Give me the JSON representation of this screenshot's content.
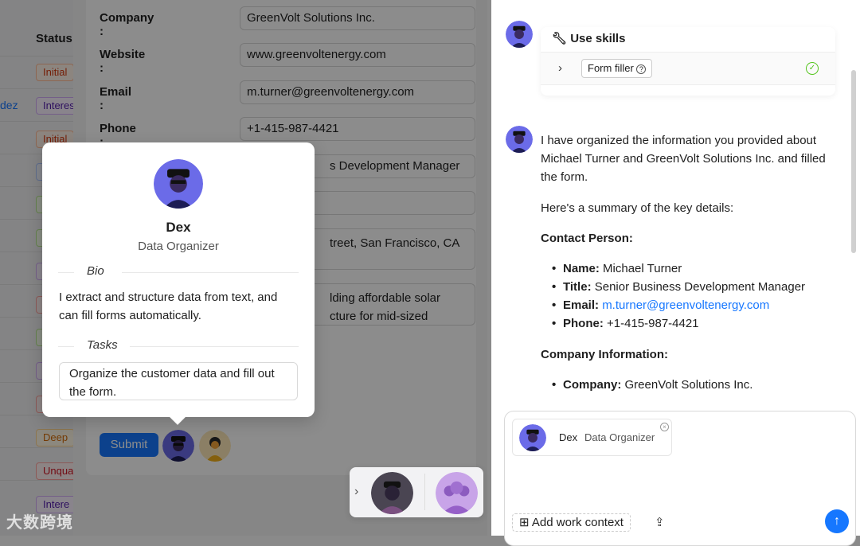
{
  "background_table": {
    "status_header": "Status",
    "name_fragment": "dez",
    "tags": [
      "Initial",
      "Interes",
      "Initial",
      "Deep",
      "Unqua",
      "Intere"
    ]
  },
  "form": {
    "fields": [
      {
        "label": "Company :",
        "value": "GreenVolt Solutions Inc."
      },
      {
        "label": "Website :",
        "value": "www.greenvoltenergy.com"
      },
      {
        "label": "Email :",
        "value": "m.turner@greenvoltenergy.com"
      },
      {
        "label": "Phone :",
        "value": "+1-415-987-4421"
      }
    ],
    "title_fragment": "s Development Manager",
    "address_fragment": "treet, San Francisco, CA",
    "desc_line1": "lding affordable solar",
    "desc_line2": "cture for mid-sized",
    "submit_label": "Submit"
  },
  "popover": {
    "name": "Dex",
    "role": "Data Organizer",
    "bio_label": "Bio",
    "bio": "I extract and structure data from text, and can fill forms automatically.",
    "tasks_label": "Tasks",
    "task": "Organize the customer data and fill out the form."
  },
  "chat": {
    "skills_title": "Use skills",
    "skill_name": "Form filler",
    "intro": "I have organized the information you provided about Michael Turner and GreenVolt Solutions Inc. and filled the form.",
    "summary_intro": "Here's a summary of the key details:",
    "contact_heading": "Contact Person:",
    "contact": {
      "name_label": "Name:",
      "name": "Michael Turner",
      "title_label": "Title:",
      "title": "Senior Business Development Manager",
      "email_label": "Email:",
      "email": "m.turner@greenvoltenergy.com",
      "phone_label": "Phone:",
      "phone": "+1-415-987-4421"
    },
    "company_heading": "Company Information:",
    "company_label": "Company:",
    "company": "GreenVolt Solutions Inc."
  },
  "composer": {
    "agent_name": "Dex",
    "agent_role": "Data Organizer",
    "add_context": "Add work context"
  },
  "watermark": "大数跨境",
  "colors": {
    "accent": "#1677ff",
    "agent_avatar_bg": "#5b5be0",
    "success": "#52c41a"
  }
}
